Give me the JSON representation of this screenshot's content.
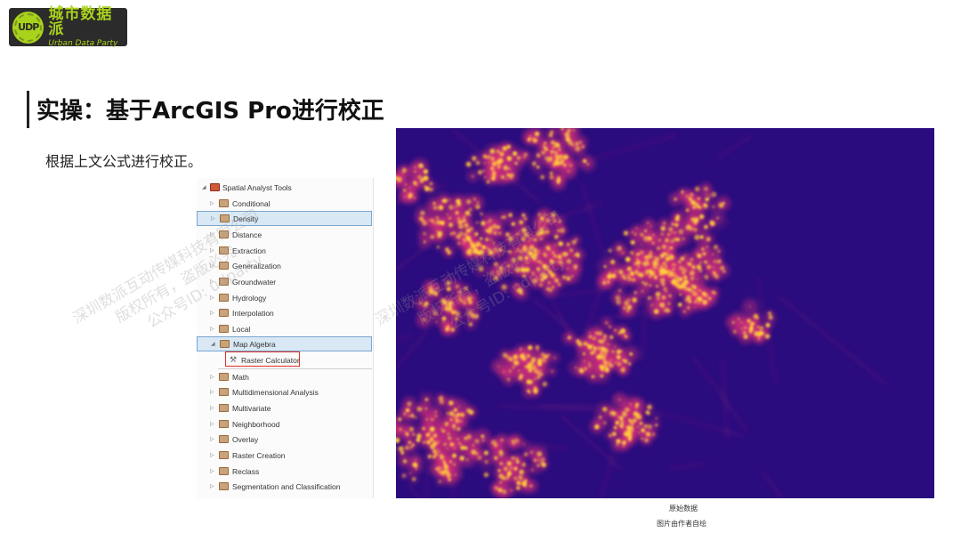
{
  "logo": {
    "badge": "UDP",
    "cn": "城市数据派",
    "en": "Urban Data Party"
  },
  "title": "实操：基于ArcGIS Pro进行校正",
  "subtitle": "根据上文公式进行校正。",
  "tree": {
    "root": "Spatial Analyst Tools",
    "items": [
      {
        "label": "Conditional"
      },
      {
        "label": "Density"
      },
      {
        "label": "Distance"
      },
      {
        "label": "Extraction"
      },
      {
        "label": "Generalization"
      },
      {
        "label": "Groundwater"
      },
      {
        "label": "Hydrology"
      },
      {
        "label": "Interpolation"
      },
      {
        "label": "Local"
      },
      {
        "label": "Map Algebra"
      },
      {
        "label": "Raster Calculator"
      },
      {
        "label": "Math"
      },
      {
        "label": "Multidimensional Analysis"
      },
      {
        "label": "Multivariate"
      },
      {
        "label": "Neighborhood"
      },
      {
        "label": "Overlay"
      },
      {
        "label": "Raster Creation"
      },
      {
        "label": "Reclass"
      },
      {
        "label": "Segmentation and Classification"
      }
    ]
  },
  "map": {
    "background_color": "#2a0c7e",
    "light_color": "#ffd23a",
    "mid_color": "#e0317a"
  },
  "captions": {
    "line1": "原始数据",
    "line2": "图片由作者自绘"
  },
  "watermark": {
    "line1": "深圳数派互动传媒科技有限公司",
    "line2": "版权所有，盗版必究",
    "line3": "公众号ID: udparty"
  }
}
